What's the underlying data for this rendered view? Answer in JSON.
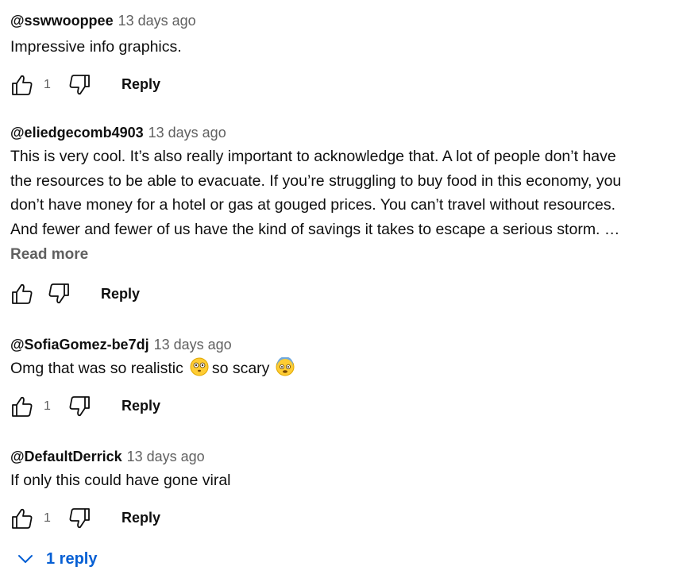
{
  "comments": [
    {
      "author": "@sswwooppee",
      "time": "13 days ago",
      "text": "Impressive info graphics.",
      "likes": "1",
      "reply_label": "Reply"
    },
    {
      "author": "@eliedgecomb4903",
      "time": "13 days ago",
      "lines": [
        "This is very cool. It’s also really important to acknowledge that. A lot of people don’t have",
        "the resources to be able to evacuate. If you’re struggling to buy food in this economy, you",
        "don’t have money for a hotel or gas at gouged prices. You can’t travel without resources.",
        "And fewer and fewer of us have the kind of savings it takes to escape a serious storm. …"
      ],
      "read_more": "Read more",
      "likes": "",
      "reply_label": "Reply"
    },
    {
      "author": "@SofiaGomez-be7dj",
      "time": "13 days ago",
      "text_part1": "Omg that was so realistic",
      "emoji1": "flushed-face-emoji",
      "text_part2": "so scary",
      "emoji2": "fearful-face-emoji",
      "likes": "1",
      "reply_label": "Reply"
    },
    {
      "author": "@DefaultDerrick",
      "time": "13 days ago",
      "text": "If only this could have gone viral",
      "likes": "1",
      "reply_label": "Reply",
      "replies_label": "1 reply"
    }
  ],
  "colors": {
    "accent": "#065fd4",
    "secondary_text": "#606060",
    "primary_text": "#0f0f0f"
  }
}
